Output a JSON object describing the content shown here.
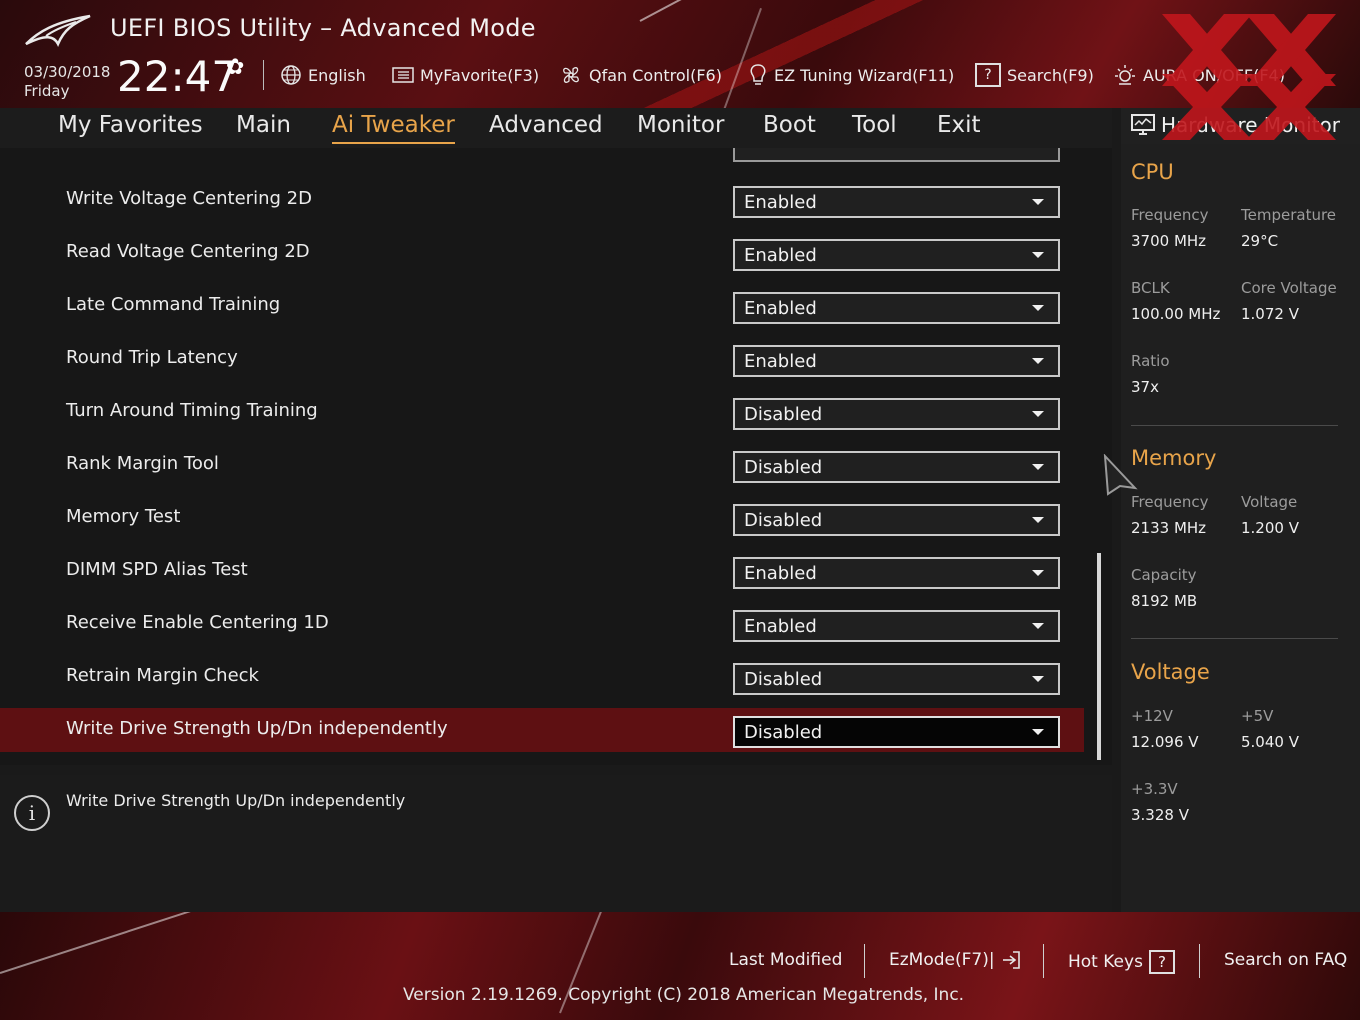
{
  "app": {
    "title": "UEFI BIOS Utility – Advanced Mode"
  },
  "clock": {
    "date": "03/30/2018",
    "day": "Friday",
    "time": "22:47"
  },
  "toolbar": {
    "language": "English",
    "myfavorite": "MyFavorite(F3)",
    "qfan": "Qfan Control(F6)",
    "ez_tuning": "EZ Tuning Wizard(F11)",
    "search": "Search(F9)",
    "aura": "AURA ON/OFF(F4)"
  },
  "nav": {
    "tabs": [
      {
        "label": "My Favorites",
        "active": false
      },
      {
        "label": "Main",
        "active": false
      },
      {
        "label": "Ai Tweaker",
        "active": true
      },
      {
        "label": "Advanced",
        "active": false
      },
      {
        "label": "Monitor",
        "active": false
      },
      {
        "label": "Boot",
        "active": false
      },
      {
        "label": "Tool",
        "active": false
      },
      {
        "label": "Exit",
        "active": false
      }
    ]
  },
  "settings": {
    "rows": [
      {
        "label": "Write Voltage Centering 2D",
        "value": "Enabled"
      },
      {
        "label": "Read Voltage Centering 2D",
        "value": "Enabled"
      },
      {
        "label": "Late Command Training",
        "value": "Enabled"
      },
      {
        "label": "Round Trip Latency",
        "value": "Enabled"
      },
      {
        "label": "Turn Around Timing Training",
        "value": "Disabled"
      },
      {
        "label": "Rank Margin Tool",
        "value": "Disabled"
      },
      {
        "label": "Memory Test",
        "value": "Disabled"
      },
      {
        "label": "DIMM SPD Alias Test",
        "value": "Enabled"
      },
      {
        "label": "Receive Enable Centering 1D",
        "value": "Enabled"
      },
      {
        "label": "Retrain Margin Check",
        "value": "Disabled"
      },
      {
        "label": "Write Drive Strength Up/Dn independently",
        "value": "Disabled",
        "selected": true
      }
    ]
  },
  "help": {
    "text": "Write Drive Strength Up/Dn independently"
  },
  "hw_monitor": {
    "title": "Hardware Monitor",
    "cpu": {
      "heading": "CPU",
      "frequency_label": "Frequency",
      "frequency": "3700 MHz",
      "temperature_label": "Temperature",
      "temperature": "29°C",
      "bclk_label": "BCLK",
      "bclk": "100.00 MHz",
      "core_voltage_label": "Core Voltage",
      "core_voltage": "1.072 V",
      "ratio_label": "Ratio",
      "ratio": "37x"
    },
    "memory": {
      "heading": "Memory",
      "frequency_label": "Frequency",
      "frequency": "2133 MHz",
      "voltage_label": "Voltage",
      "voltage": "1.200 V",
      "capacity_label": "Capacity",
      "capacity": "8192 MB"
    },
    "voltage": {
      "heading": "Voltage",
      "v12_label": "+12V",
      "v12": "12.096 V",
      "v5_label": "+5V",
      "v5": "5.040 V",
      "v33_label": "+3.3V",
      "v33": "3.328 V"
    }
  },
  "footer": {
    "last_modified": "Last Modified",
    "ezmode": "EzMode(F7)|",
    "hot_keys": "Hot Keys",
    "hot_keys_key": "?",
    "search_faq": "Search on FAQ",
    "version": "Version 2.19.1269. Copyright (C) 2018 American Megatrends, Inc."
  },
  "colors": {
    "accent": "#e8a44a",
    "selected_row": "#5e1012",
    "brand_red": "#c0161c"
  }
}
